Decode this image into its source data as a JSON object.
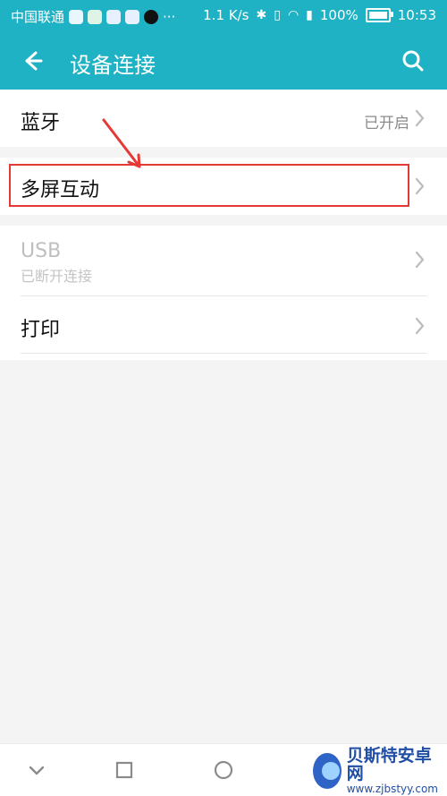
{
  "status_bar": {
    "carrier": "中国联通",
    "network_speed": "1.1 K/s",
    "battery_percent": "100%",
    "time": "10:53",
    "icons": [
      "shield-icon",
      "app-icon",
      "app-icon",
      "app-icon",
      "tiktok-icon",
      "more-icon",
      "bluetooth-icon",
      "vibrate-icon",
      "wifi-icon",
      "signal-icon",
      "battery-icon"
    ]
  },
  "header": {
    "title": "设备连接"
  },
  "list": {
    "bluetooth": {
      "label": "蓝牙",
      "status": "已开启"
    },
    "multiscreen": {
      "label": "多屏互动"
    },
    "usb": {
      "label": "USB",
      "status": "已断开连接"
    },
    "print": {
      "label": "打印"
    }
  },
  "watermark": {
    "title": "贝斯特安卓网",
    "url": "www.zjbstyy.com"
  },
  "colors": {
    "primary": "#1fb2c4",
    "highlight": "#e53935"
  }
}
